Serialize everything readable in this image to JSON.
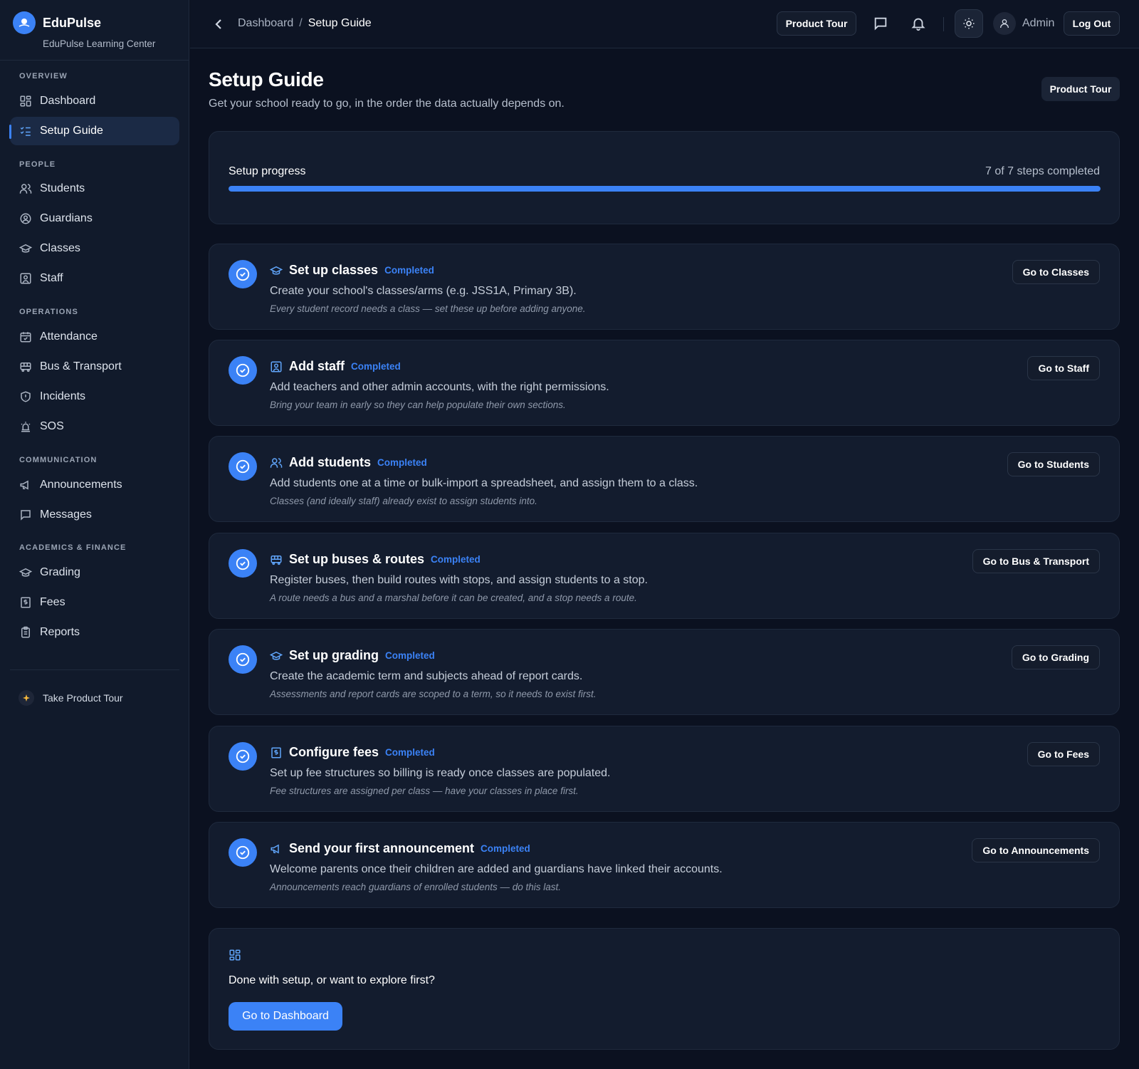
{
  "brand": {
    "name": "EduPulse",
    "subtitle": "EduPulse Learning Center"
  },
  "sidebar": {
    "sections": [
      {
        "title": "OVERVIEW"
      },
      {
        "title": "PEOPLE"
      },
      {
        "title": "OPERATIONS"
      },
      {
        "title": "COMMUNICATION"
      },
      {
        "title": "ACADEMICS & FINANCE"
      }
    ],
    "items": [
      {
        "label": "Dashboard",
        "icon": "dashboard-icon"
      },
      {
        "label": "Setup Guide",
        "icon": "checklist-icon",
        "active": true
      },
      {
        "label": "Students",
        "icon": "users-icon"
      },
      {
        "label": "Guardians",
        "icon": "user-circle-icon"
      },
      {
        "label": "Classes",
        "icon": "graduation-cap-icon"
      },
      {
        "label": "Staff",
        "icon": "id-badge-icon"
      },
      {
        "label": "Attendance",
        "icon": "calendar-check-icon"
      },
      {
        "label": "Bus & Transport",
        "icon": "bus-icon"
      },
      {
        "label": "Incidents",
        "icon": "shield-alert-icon"
      },
      {
        "label": "SOS",
        "icon": "siren-icon"
      },
      {
        "label": "Announcements",
        "icon": "megaphone-icon"
      },
      {
        "label": "Messages",
        "icon": "message-square-icon"
      },
      {
        "label": "Grading",
        "icon": "graduation-cap-icon"
      },
      {
        "label": "Fees",
        "icon": "receipt-icon"
      },
      {
        "label": "Reports",
        "icon": "clipboard-icon"
      }
    ],
    "tour_label": "Take Product Tour"
  },
  "topbar": {
    "breadcrumb_parent": "Dashboard",
    "breadcrumb_sep": "/",
    "breadcrumb_current": "Setup Guide",
    "product_tour_label": "Product Tour",
    "user_name": "Admin",
    "logout_label": "Log Out"
  },
  "page": {
    "title": "Setup Guide",
    "subtitle": "Get your school ready to go, in the order the data actually depends on.",
    "product_tour_label": "Product Tour"
  },
  "progress": {
    "label": "Setup progress",
    "count_text": "7 of 7 steps completed",
    "fraction": 1.0
  },
  "steps": [
    {
      "title": "Set up classes",
      "status": "Completed",
      "icon": "graduation-cap-icon",
      "description": "Create your school's classes/arms (e.g. JSS1A, Primary 3B).",
      "note": "Every student record needs a class — set these up before adding anyone.",
      "button": "Go to Classes"
    },
    {
      "title": "Add staff",
      "status": "Completed",
      "icon": "id-badge-icon",
      "description": "Add teachers and other admin accounts, with the right permissions.",
      "note": "Bring your team in early so they can help populate their own sections.",
      "button": "Go to Staff"
    },
    {
      "title": "Add students",
      "status": "Completed",
      "icon": "users-icon",
      "description": "Add students one at a time or bulk-import a spreadsheet, and assign them to a class.",
      "note": "Classes (and ideally staff) already exist to assign students into.",
      "button": "Go to Students"
    },
    {
      "title": "Set up buses & routes",
      "status": "Completed",
      "icon": "bus-icon",
      "description": "Register buses, then build routes with stops, and assign students to a stop.",
      "note": "A route needs a bus and a marshal before it can be created, and a stop needs a route.",
      "button": "Go to Bus & Transport"
    },
    {
      "title": "Set up grading",
      "status": "Completed",
      "icon": "graduation-cap-icon",
      "description": "Create the academic term and subjects ahead of report cards.",
      "note": "Assessments and report cards are scoped to a term, so it needs to exist first.",
      "button": "Go to Grading"
    },
    {
      "title": "Configure fees",
      "status": "Completed",
      "icon": "receipt-icon",
      "description": "Set up fee structures so billing is ready once classes are populated.",
      "note": "Fee structures are assigned per class — have your classes in place first.",
      "button": "Go to Fees"
    },
    {
      "title": "Send your first announcement",
      "status": "Completed",
      "icon": "megaphone-icon",
      "description": "Welcome parents once their children are added and guardians have linked their accounts.",
      "note": "Announcements reach guardians of enrolled students — do this last.",
      "button": "Go to Announcements"
    }
  ],
  "finish": {
    "text": "Done with setup, or want to explore first?",
    "button": "Go to Dashboard"
  },
  "colors": {
    "accent": "#3b82f6",
    "background": "#0b1120",
    "card": "#131c2e",
    "sidebar": "#111a2b"
  }
}
